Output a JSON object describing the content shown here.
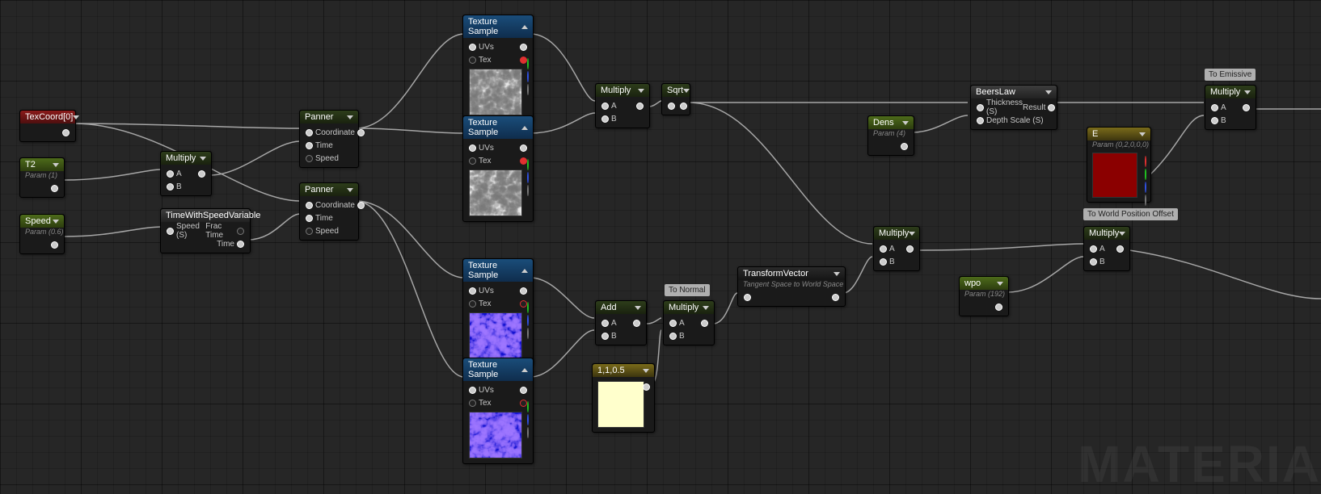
{
  "nodes": {
    "texcoord": {
      "title": "TexCoord[0]"
    },
    "t2": {
      "title": "T2",
      "param": "Param (1)"
    },
    "speed": {
      "title": "Speed",
      "param": "Param (0.6)"
    },
    "multiply1": {
      "title": "Multiply",
      "inputs_ab": [
        "A",
        "B"
      ]
    },
    "timewsv": {
      "title": "TimeWithSpeedVariable",
      "inputs": [
        "Speed (S)"
      ],
      "outputs": [
        "Frac Time",
        "Time"
      ]
    },
    "panner1": {
      "title": "Panner",
      "inputs": [
        "Coordinate",
        "Time",
        "Speed"
      ]
    },
    "panner2": {
      "title": "Panner",
      "inputs": [
        "Coordinate",
        "Time",
        "Speed"
      ]
    },
    "texsamp1": {
      "title": "Texture Sample",
      "inputs": [
        "UVs",
        "Tex"
      ]
    },
    "texsamp2": {
      "title": "Texture Sample",
      "inputs": [
        "UVs",
        "Tex"
      ]
    },
    "texsamp3": {
      "title": "Texture Sample",
      "inputs": [
        "UVs",
        "Tex"
      ]
    },
    "texsamp4": {
      "title": "Texture Sample",
      "inputs": [
        "UVs",
        "Tex"
      ]
    },
    "multiply2": {
      "title": "Multiply",
      "inputs_ab": [
        "A",
        "B"
      ]
    },
    "sqrt": {
      "title": "Sqrt"
    },
    "beerslaw": {
      "title": "BeersLaw",
      "inputs": [
        "Thickness (S)",
        "Depth Scale (S)"
      ],
      "outputs": [
        "Result"
      ]
    },
    "dens": {
      "title": "Dens",
      "param": "Param (4)"
    },
    "e": {
      "title": "E",
      "param": "Param (0,2,0,0,0)"
    },
    "multiply3": {
      "title": "Multiply",
      "inputs_ab": [
        "A",
        "B"
      ]
    },
    "add": {
      "title": "Add",
      "inputs_ab": [
        "A",
        "B"
      ]
    },
    "multiply4": {
      "title": "Multiply",
      "inputs_ab": [
        "A",
        "B"
      ]
    },
    "const": {
      "title": "1,1,0.5"
    },
    "transform": {
      "title": "TransformVector",
      "sub": "Tangent Space to World Space"
    },
    "multiply5": {
      "title": "Multiply",
      "inputs_ab": [
        "A",
        "B"
      ]
    },
    "wpo": {
      "title": "wpo",
      "param": "Param (192)"
    },
    "multiply6": {
      "title": "Multiply",
      "inputs_ab": [
        "A",
        "B"
      ]
    }
  },
  "comments": {
    "to_emissive": "To Emissive",
    "to_normal": "To Normal",
    "to_wpo": "To World Position Offset"
  },
  "watermark": "MATERIA"
}
